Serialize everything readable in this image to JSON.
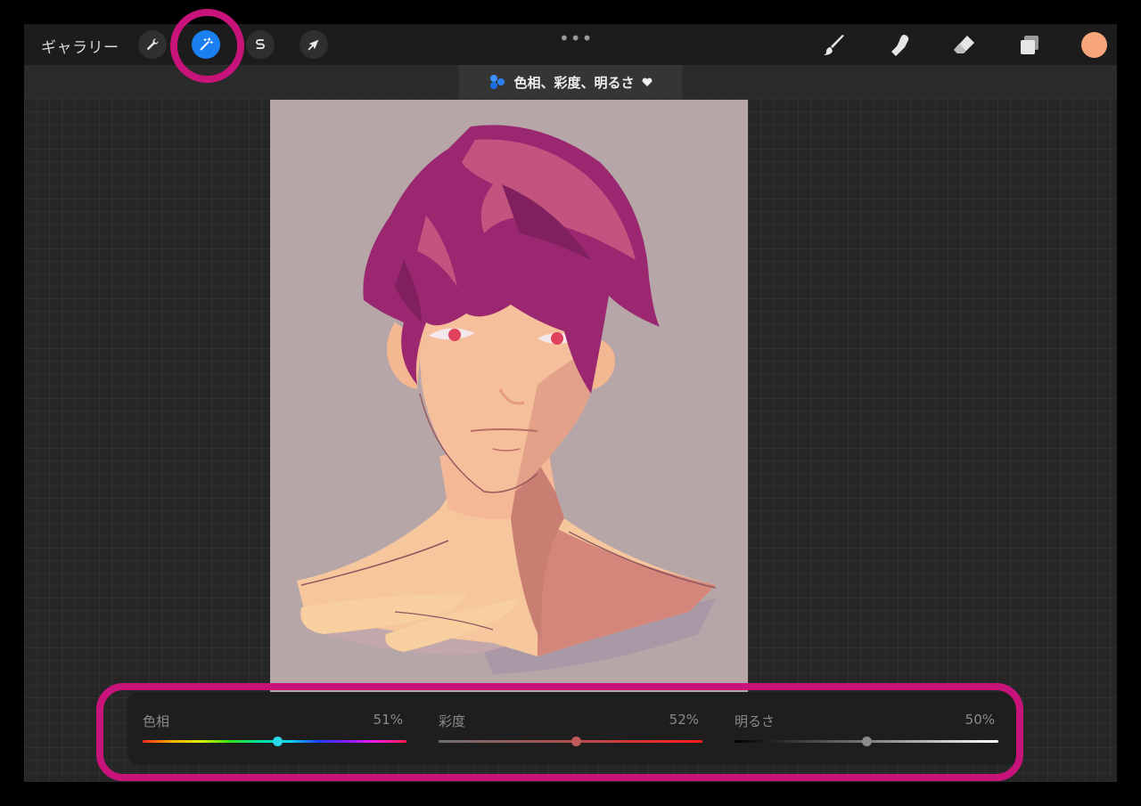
{
  "toolbar": {
    "gallery_label": "ギャラリー",
    "more_label": "•••",
    "icons": {
      "actions": "wrench-icon",
      "adjustments": "magic-wand-icon",
      "selection": "selection-s-icon",
      "transform": "arrow-cursor-icon",
      "brush": "brush-icon",
      "smudge": "smudge-finger-icon",
      "eraser": "eraser-icon",
      "layers": "layers-icon"
    },
    "active_tool": "adjustments",
    "current_color": "#f7a57a"
  },
  "mode": {
    "title": "色相、彩度、明るさ",
    "icon": "hsb-dots-icon",
    "caret": "heart-caret-icon"
  },
  "adjustments": [
    {
      "key": "hue",
      "label": "色相",
      "value_text": "51%",
      "value": 0.51,
      "thumb_color": "#2ad7e6"
    },
    {
      "key": "saturation",
      "label": "彩度",
      "value_text": "52%",
      "value": 0.52,
      "thumb_color": "#c25a5a"
    },
    {
      "key": "brightness",
      "label": "明るさ",
      "value_text": "50%",
      "value": 0.5,
      "thumb_color": "#8a8a8a"
    }
  ],
  "colors": {
    "accent": "#1a7ff0",
    "highlight": "#c8137a",
    "canvas_bg": "#b6a6a7"
  }
}
